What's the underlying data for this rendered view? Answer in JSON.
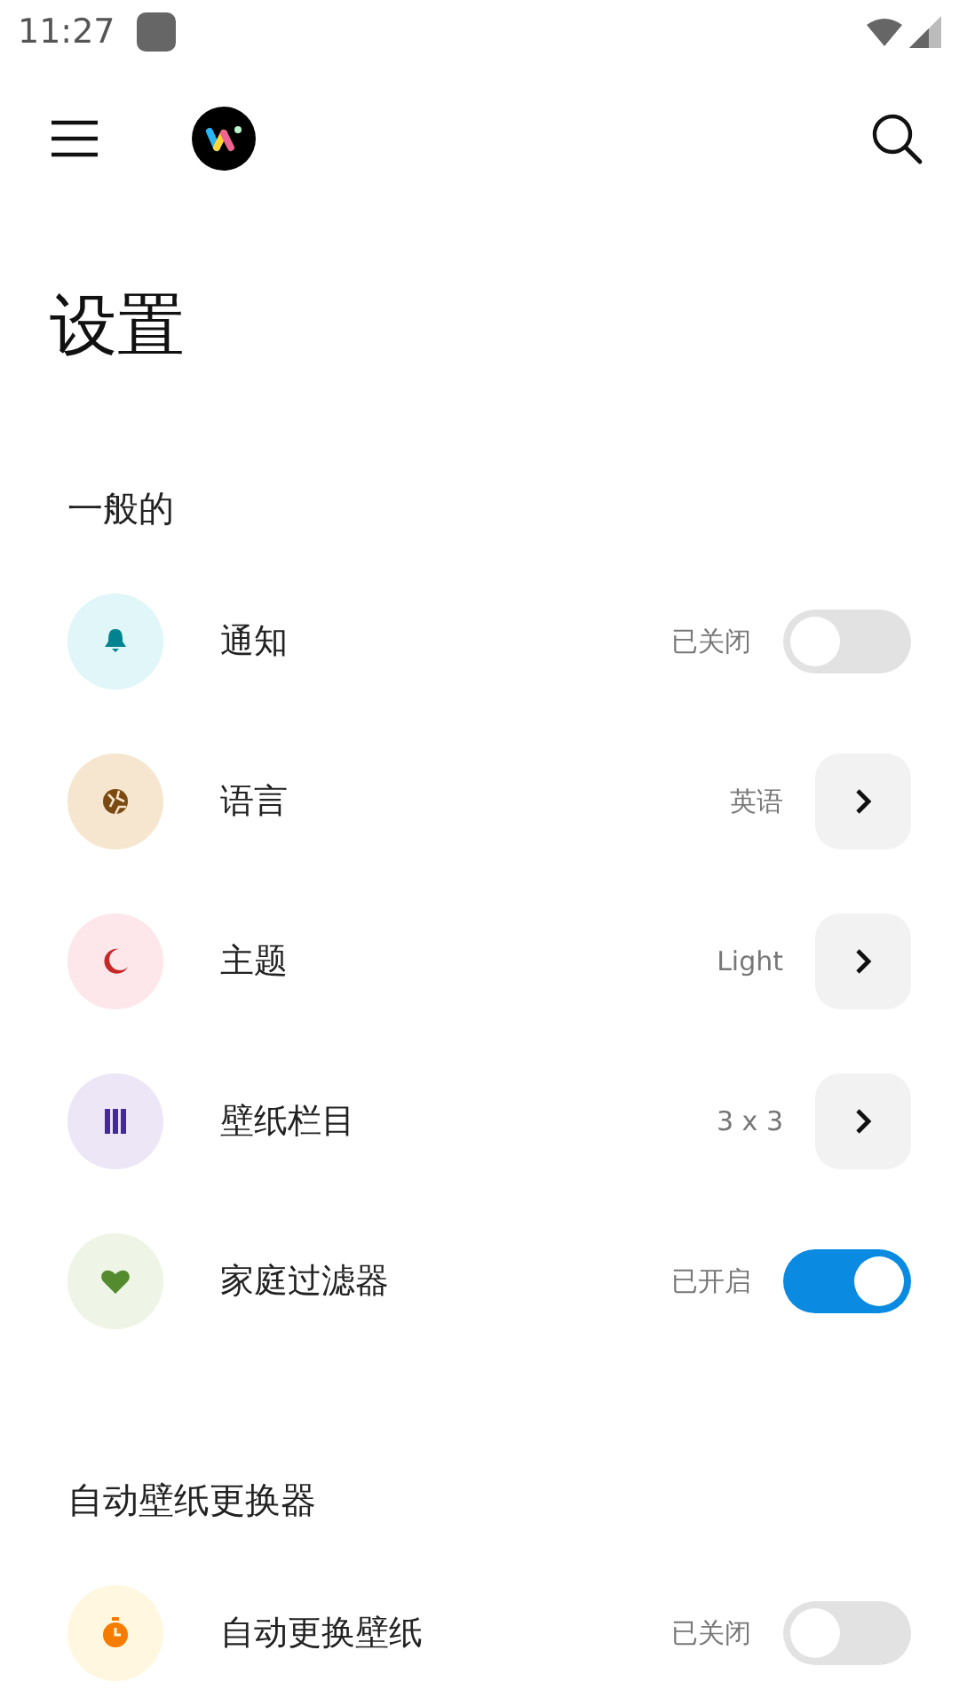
{
  "status_bar": {
    "time": "11:27"
  },
  "page_title": "设置",
  "sections": [
    {
      "title": "一般的",
      "items": [
        {
          "kind": "toggle",
          "label": "通知",
          "value": "已关闭",
          "on": false,
          "color": "#00838f"
        },
        {
          "kind": "link",
          "label": "语言",
          "value": "英语",
          "color": "#7a4a12"
        },
        {
          "kind": "link",
          "label": "主题",
          "value": "Light",
          "color": "#c62828"
        },
        {
          "kind": "link",
          "label": "壁纸栏目",
          "value": "3 x 3",
          "color": "#4527a0"
        },
        {
          "kind": "toggle",
          "label": "家庭过滤器",
          "value": "已开启",
          "on": true,
          "color": "#558b2f"
        }
      ]
    },
    {
      "title": "自动壁纸更换器",
      "items": [
        {
          "kind": "toggle",
          "label": "自动更换壁纸",
          "value": "已关闭",
          "on": false,
          "color": "#f57c00"
        }
      ]
    }
  ]
}
